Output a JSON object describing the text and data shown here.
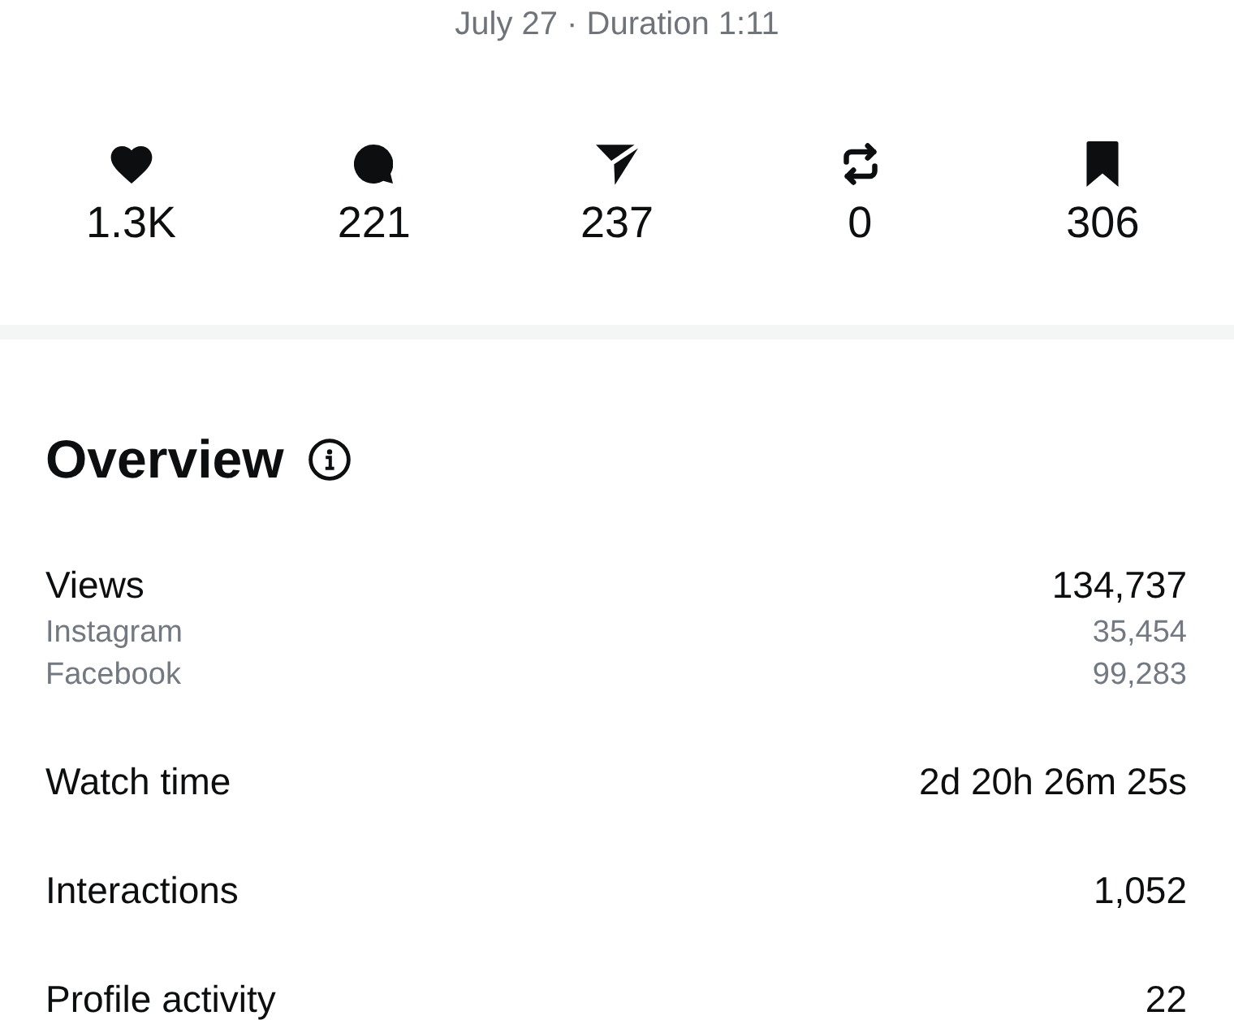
{
  "subtitle": "July 27 · Duration 1:11",
  "stats": [
    {
      "kind": "likes",
      "value": "1.3K"
    },
    {
      "kind": "comments",
      "value": "221"
    },
    {
      "kind": "shares",
      "value": "237"
    },
    {
      "kind": "reposts",
      "value": "0"
    },
    {
      "kind": "saves",
      "value": "306"
    }
  ],
  "overview": {
    "title": "Overview",
    "rows": [
      {
        "label": "Views",
        "value": "134,737",
        "breakdown": [
          {
            "label": "Instagram",
            "value": "35,454"
          },
          {
            "label": "Facebook",
            "value": "99,283"
          }
        ]
      },
      {
        "label": "Watch time",
        "value": "2d 20h 26m 25s"
      },
      {
        "label": "Interactions",
        "value": "1,052"
      },
      {
        "label": "Profile activity",
        "value": "22"
      }
    ]
  }
}
